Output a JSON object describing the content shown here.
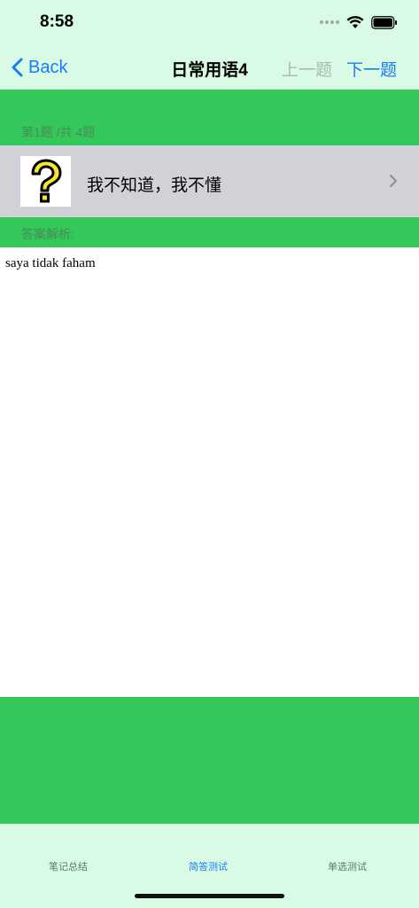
{
  "status_bar": {
    "time": "8:58"
  },
  "nav": {
    "back_label": "Back",
    "title": "日常用语4",
    "prev_label": "上一题",
    "next_label": "下一题"
  },
  "question": {
    "index_text": "第1题 /共 4题",
    "text": "我不知道，我不懂",
    "image_icon": "question-mark-icon"
  },
  "answer": {
    "label": "答案解析:",
    "text": "saya tidak faham"
  },
  "tabs": [
    {
      "label": "笔记总结",
      "active": false
    },
    {
      "label": "简答测试",
      "active": true
    },
    {
      "label": "单选测试",
      "active": false
    }
  ],
  "colors": {
    "nav_bg": "#d9fbe5",
    "green": "#34c759",
    "accent": "#1a7cf5",
    "disabled": "#a9b9b0"
  }
}
